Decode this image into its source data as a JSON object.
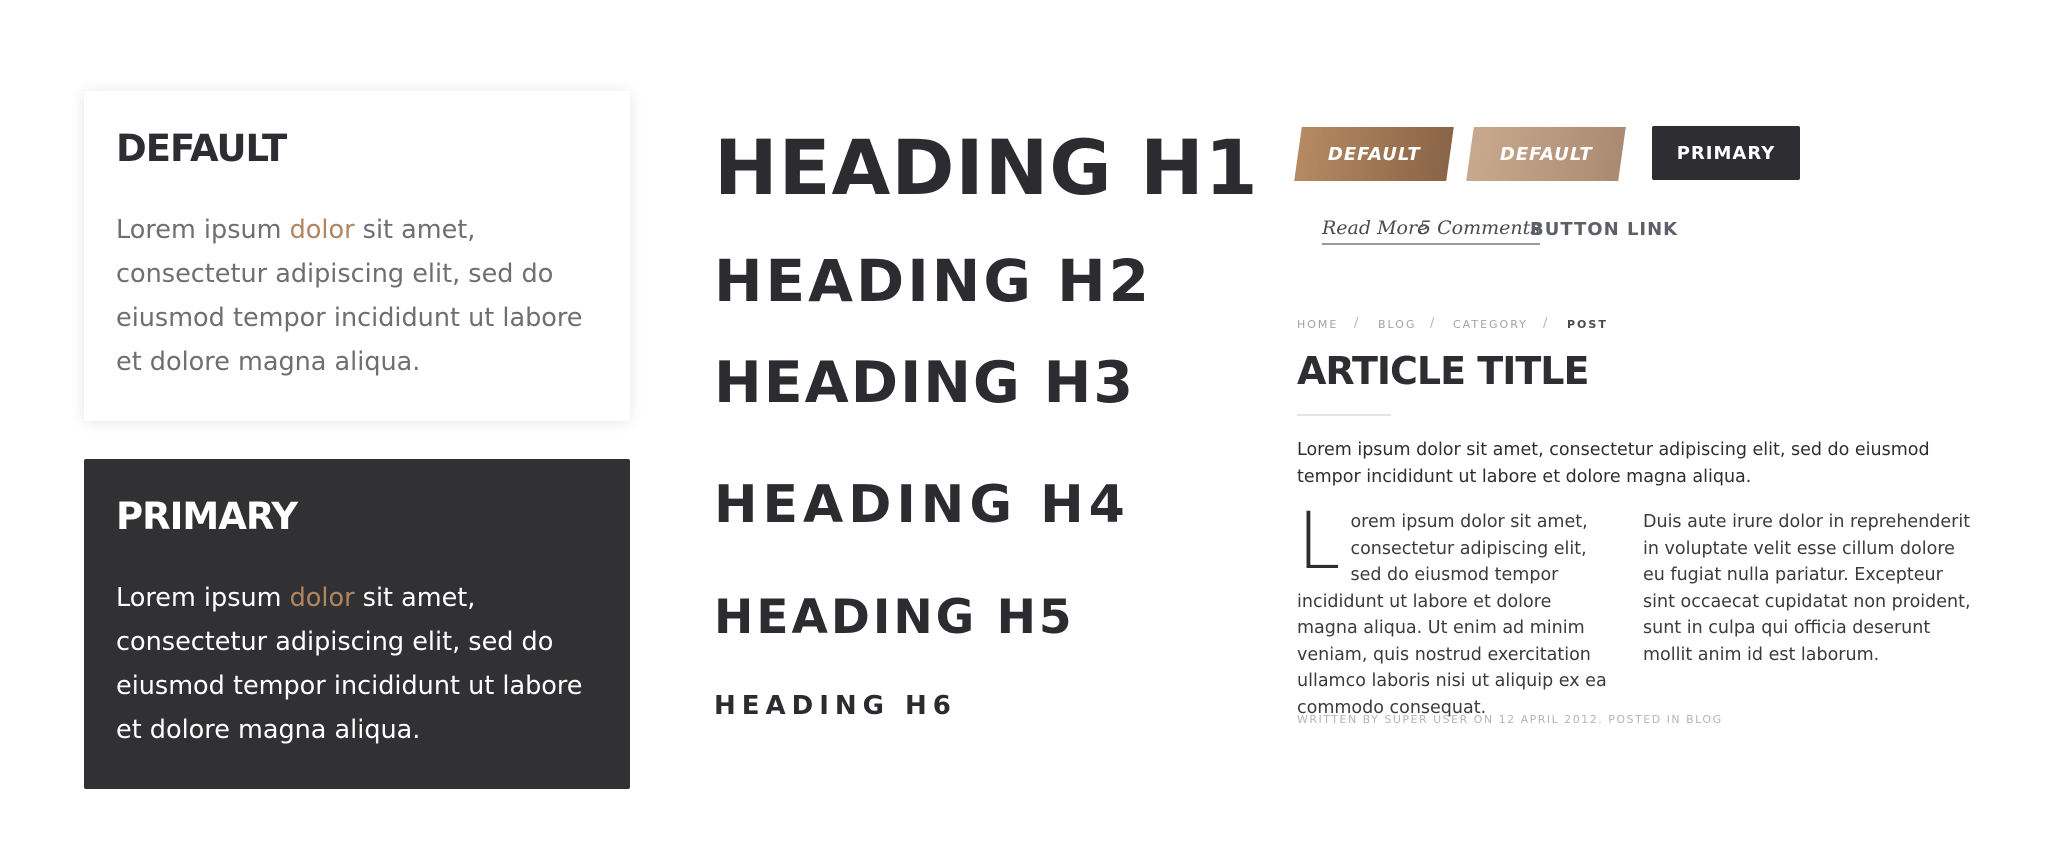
{
  "cards": {
    "default": {
      "title": "DEFAULT",
      "text_before": "Lorem ipsum ",
      "highlight": "dolor",
      "text_after": " sit amet, consectetur adipiscing elit, sed do eiusmod tempor incididunt ut labore et dolore magna aliqua."
    },
    "primary": {
      "title": "PRIMARY",
      "text_before": "Lorem ipsum ",
      "highlight": "dolor",
      "text_after": " sit amet, consectetur adipiscing elit, sed do eiusmod tempor incididunt ut labore et dolore magna aliqua."
    }
  },
  "headings": {
    "h1": "HEADING H1",
    "h2": "HEADING H2",
    "h3": "HEADING H3",
    "h4": "HEADING H4",
    "h5": "HEADING H5",
    "h6": "HEADING H6"
  },
  "buttons": {
    "default_1": "DEFAULT",
    "default_2": "DEFAULT",
    "primary": "PRIMARY",
    "read_more": "Read More",
    "comments": "5 Comments",
    "button_link": "BUTTON LINK"
  },
  "breadcrumb": {
    "items": [
      "HOME",
      "BLOG",
      "CATEGORY",
      "POST"
    ],
    "separator": "/"
  },
  "article": {
    "title": "ARTICLE TITLE",
    "lead": "Lorem ipsum dolor sit amet, consectetur adipiscing elit, sed do eiusmod tempor incididunt ut labore et dolore magna aliqua.",
    "dropcap": "L",
    "col1_text": "orem ipsum dolor sit amet, consectetur adipiscing elit, sed do eiusmod tempor incididunt ut labore et dolore magna aliqua. Ut enim ad minim veniam, quis nostrud exercitation ullamco laboris nisi ut aliquip ex ea commodo consequat.",
    "col2_text": "Duis aute irure dolor in reprehenderit in voluptate velit esse cillum dolore eu fugiat nulla pariatur. Excepteur sint occaecat cupidatat non proident, sunt in culpa qui officia deserunt mollit anim id est laborum.",
    "meta": "WRITTEN BY SUPER USER ON 12 APRIL 2012. POSTED IN BLOG"
  },
  "colors": {
    "highlight": "#b08660",
    "dark": "#2e2d31",
    "gradient_1_start": "#b58a63",
    "gradient_1_end": "#8a6447",
    "gradient_2_start": "#c9a98d",
    "gradient_2_end": "#ab8a72"
  }
}
